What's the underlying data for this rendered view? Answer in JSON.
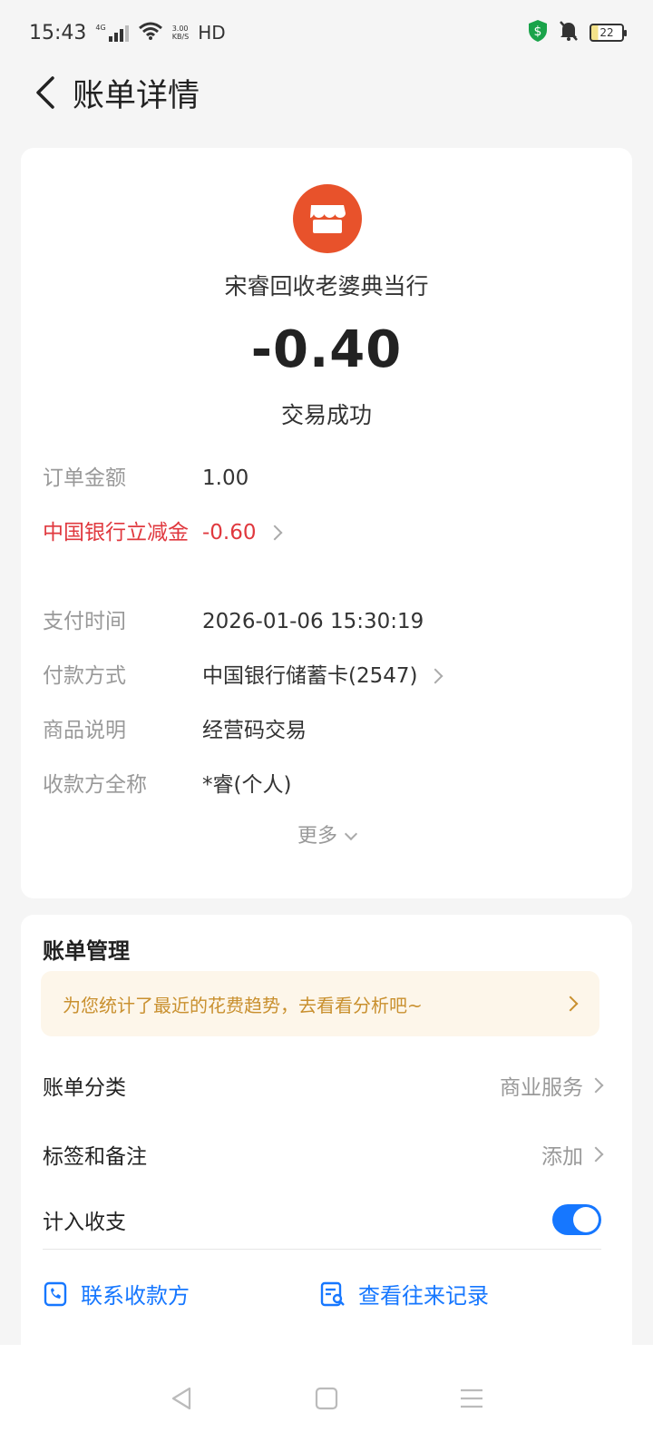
{
  "status_bar": {
    "time": "15:43",
    "network": "4G",
    "speed_value": "3.00",
    "speed_unit": "KB/S",
    "hd": "HD",
    "battery": "22"
  },
  "header": {
    "title": "账单详情"
  },
  "bill": {
    "merchant_name": "宋睿回收老婆典当行",
    "amount": "-0.40",
    "status": "交易成功",
    "details": [
      {
        "label": "订单金额",
        "value": "1.00"
      },
      {
        "label": "中国银行立减金",
        "value": "-0.60"
      },
      {
        "label": "支付时间",
        "value": "2026-01-06 15:30:19"
      },
      {
        "label": "付款方式",
        "value": "中国银行储蓄卡(2547)"
      },
      {
        "label": "商品说明",
        "value": "经营码交易"
      },
      {
        "label": "收款方全称",
        "value": "*睿(个人)"
      }
    ],
    "more_label": "更多"
  },
  "management": {
    "title": "账单管理",
    "banner_text": "为您统计了最近的花费趋势，去看看分析吧~",
    "category_label": "账单分类",
    "category_value": "商业服务",
    "tags_label": "标签和备注",
    "tags_value": "添加",
    "income_label": "计入收支",
    "income_enabled": true,
    "actions": [
      {
        "label": "联系收款方",
        "icon": "phone-icon"
      },
      {
        "label": "查看往来记录",
        "icon": "records-icon"
      }
    ]
  },
  "colors": {
    "accent": "#1677ff",
    "discount_red": "#e0383e",
    "merchant_orange": "#e8522b",
    "banner_gold": "#c9902f"
  }
}
